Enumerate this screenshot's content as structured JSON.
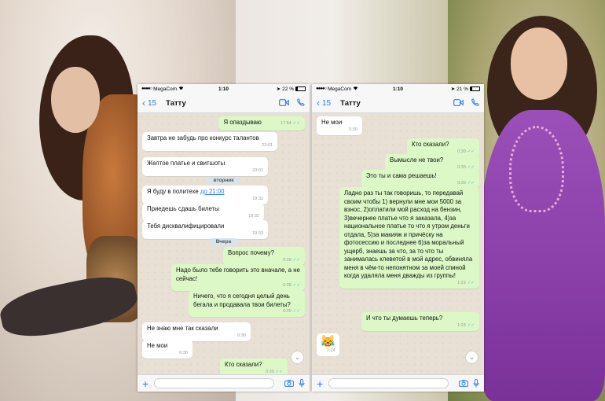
{
  "colors": {
    "accent": "#2d7cf6",
    "outgoing_bubble": "#dcf8c6",
    "incoming_bubble": "#ffffff",
    "read_ticks": "#4fb6ec"
  },
  "left_phone": {
    "status": {
      "carrier": "MegaCom",
      "time": "1:10",
      "battery": "22 %",
      "battery_level": 0.22
    },
    "header": {
      "back_count": "15",
      "contact": "Татту"
    },
    "messages": [
      {
        "text": "Я опаздываю",
        "time": "17:54",
        "dir": "out"
      },
      {
        "text": "Завтра не забудь про конкурс талантов",
        "time": "23:01",
        "dir": "in"
      },
      {
        "text": "Желтое платье и свитшоты",
        "time": "23:01",
        "dir": "in"
      },
      {
        "text_before": "Я буду в политехе ",
        "link": "до 21:00",
        "time": "19:32",
        "dir": "in"
      },
      {
        "text": "Приедешь сдашь билеты",
        "time": "19:32",
        "dir": "in"
      },
      {
        "text": "Тебя дисквалифицировали",
        "time": "19:33",
        "dir": "in"
      },
      {
        "text": "Вопрос почему?",
        "time": "0:26",
        "dir": "out"
      },
      {
        "text": "Надо было тебе говорить это вначале, а не сейчас!",
        "time": "0:28",
        "dir": "out"
      },
      {
        "text": "Ничего, что я сегодня целый день бегала и продавала твои билеты?",
        "time": "0:29",
        "dir": "out"
      },
      {
        "text": "Не знаю мне так сказали",
        "time": "0:30",
        "dir": "in"
      },
      {
        "text": "Не мои",
        "time": "0:30",
        "dir": "in"
      },
      {
        "text": "Кто сказали?",
        "time": "0:30",
        "dir": "out"
      }
    ],
    "days": [
      "вторник",
      "Вчера"
    ]
  },
  "right_phone": {
    "status": {
      "carrier": "MegaCom",
      "time": "1:10",
      "battery": "21 %",
      "battery_level": 0.21
    },
    "header": {
      "back_count": "15",
      "contact": "Татту"
    },
    "messages": [
      {
        "text": "Не мои",
        "time": "0:30",
        "dir": "in"
      },
      {
        "text": "Кто сказали?",
        "time": "0:30",
        "dir": "out"
      },
      {
        "text": "Вымысле не твои?",
        "time": "0:30",
        "dir": "out"
      },
      {
        "text": "Это ты и сама решаешь!",
        "time": "0:30",
        "dir": "out"
      },
      {
        "text": "Ладно раз ты так говоришь, то передавай своим чтобы 1) вернули мне мои 5000 за взнос, 2)оплатили мой расход на бензин, 3)вечернее платье что я заказала, 4)за национальное платье то что я утром деньги отдала, 5)за макияж и причёску на фотосессию и последнее 6)за моральный ущерб, знаешь за что, за то что ты занималась клеветой в мой адрес, обвиняла меня в чём-то непонятном за моей спиной когда удаляла меня дважды из группы!",
        "time": "1:23",
        "dir": "out"
      },
      {
        "text": "И что ты думаешь теперь?",
        "time": "1:23",
        "dir": "out"
      },
      {
        "text": "😹",
        "time": "1:24",
        "dir": "in"
      }
    ]
  }
}
